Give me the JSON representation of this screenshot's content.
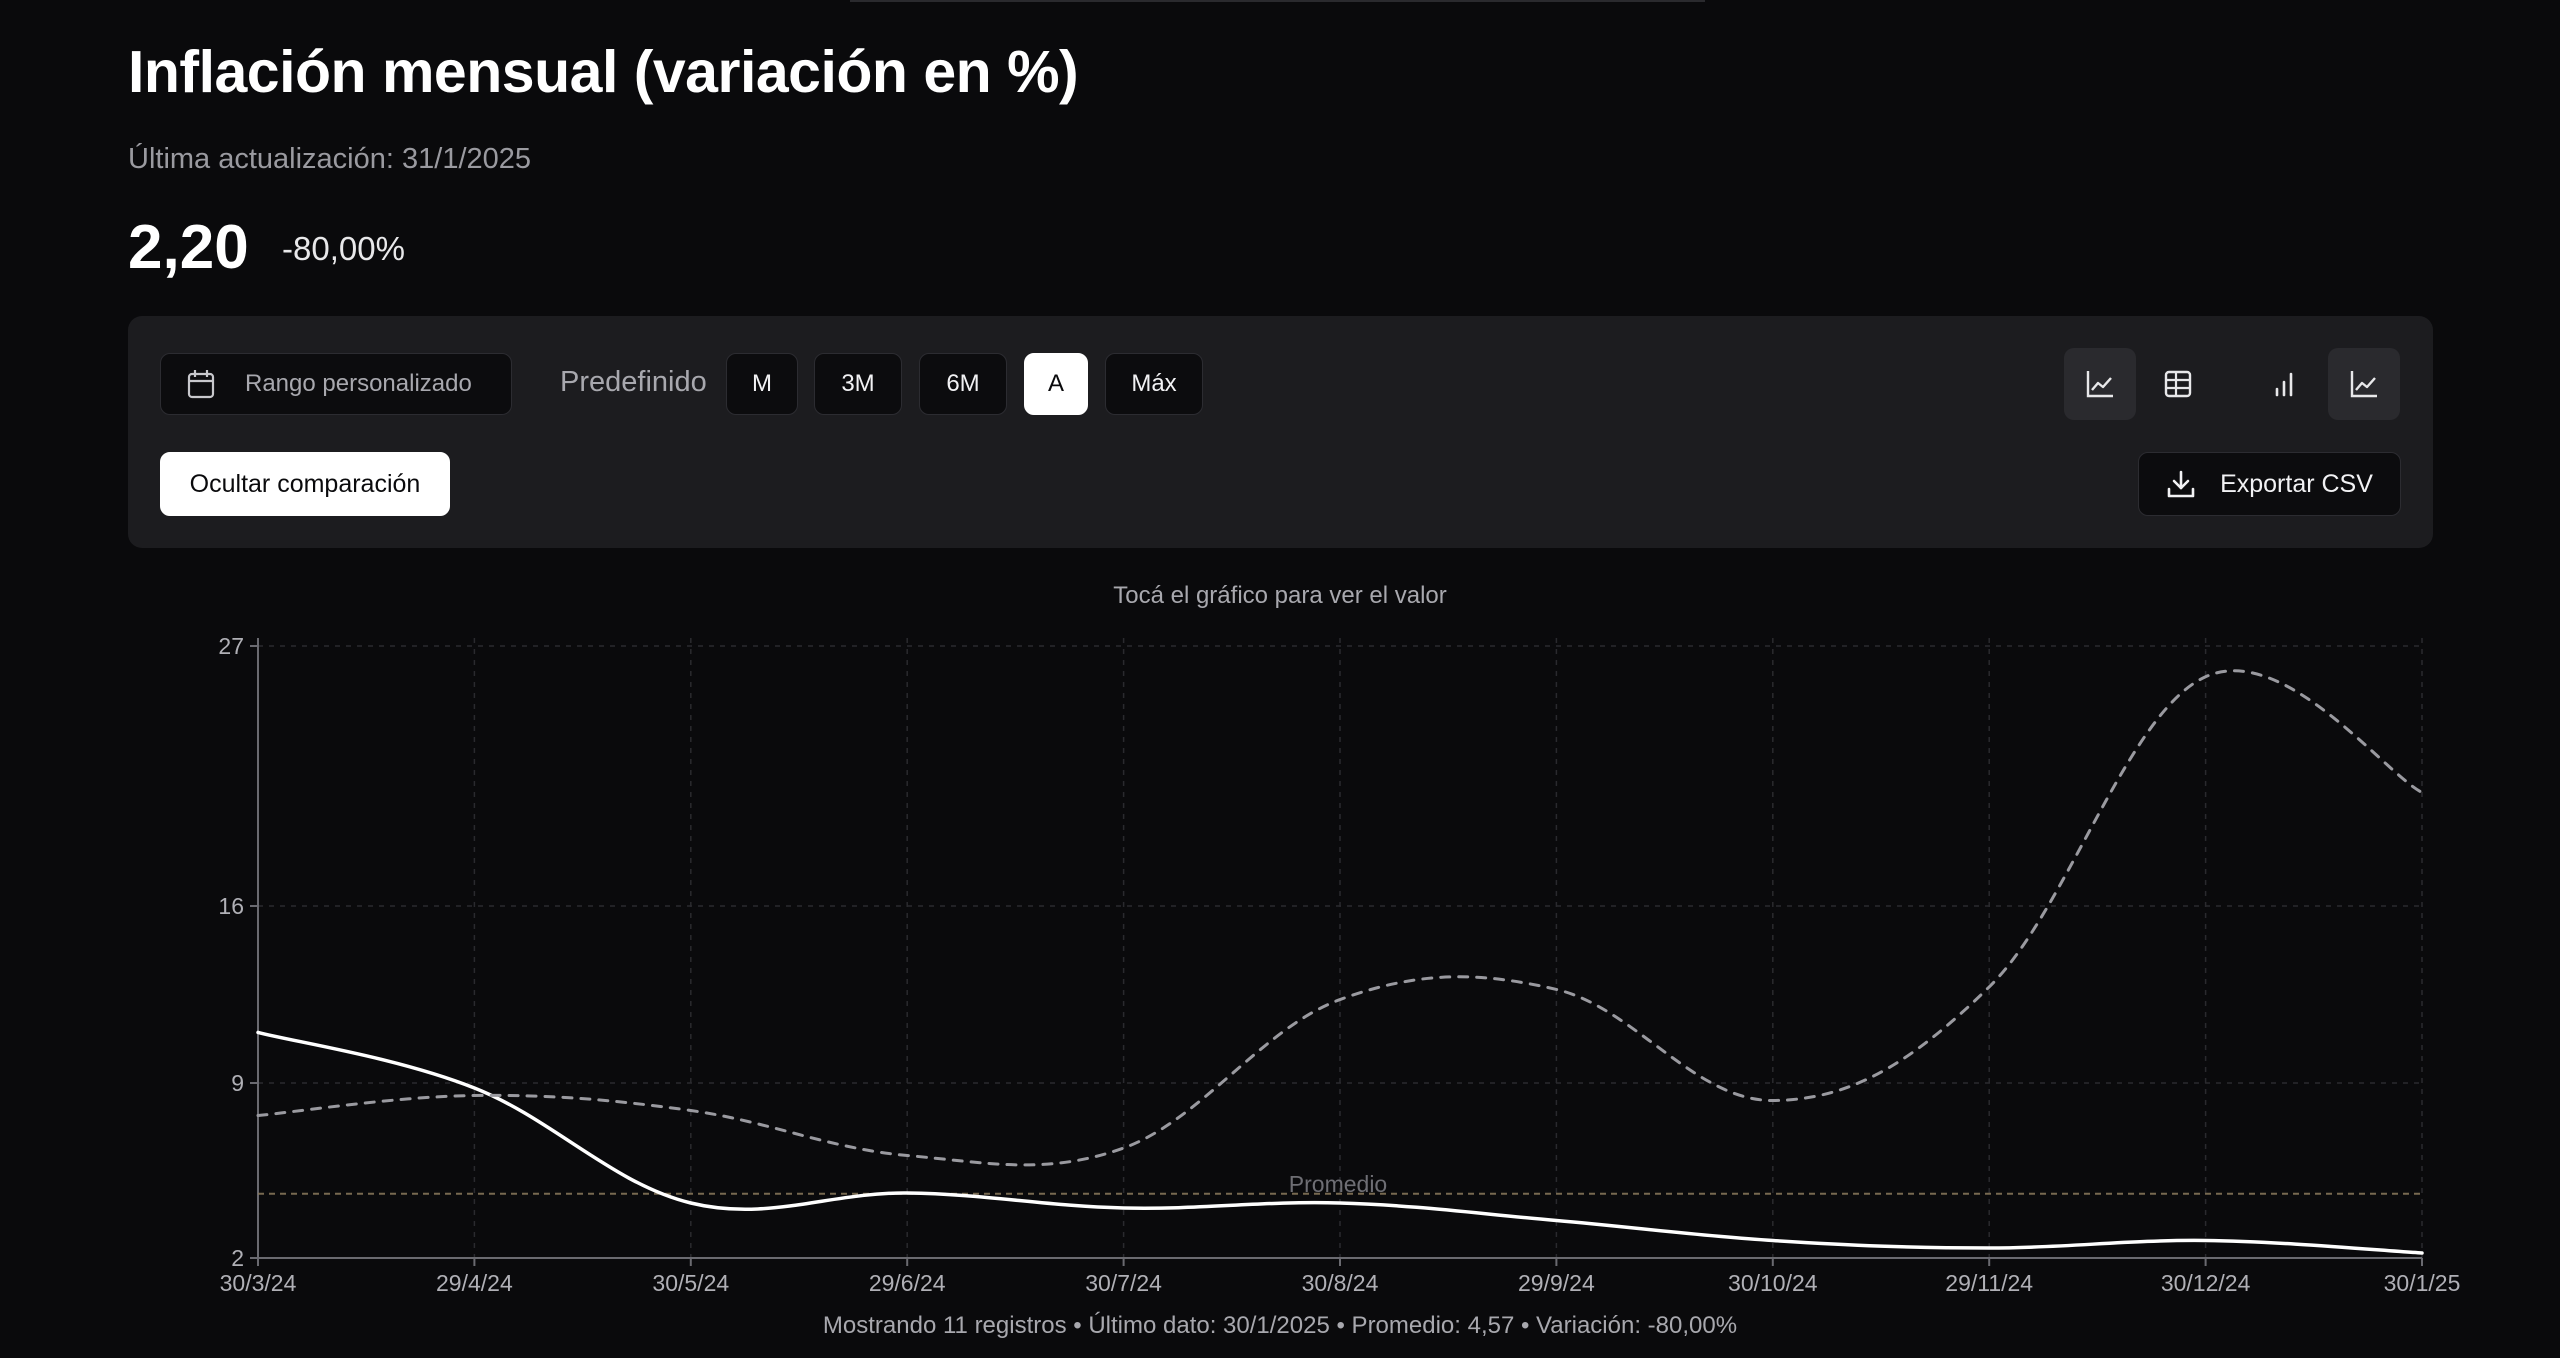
{
  "header": {
    "title": "Inflación mensual (variación en %)",
    "updated": "Última actualización: 31/1/2025",
    "value": "2,20",
    "change": "-80,00%"
  },
  "toolbar": {
    "range_label": "Rango personalizado",
    "preset_label": "Predefinido",
    "presets": [
      "M",
      "3M",
      "6M",
      "A",
      "Máx"
    ],
    "active_preset": "A",
    "hide_comparison_label": "Ocultar comparación",
    "export_label": "Exportar CSV",
    "view_icons": [
      "line-chart-icon",
      "table-icon",
      "bar-chart-icon",
      "line-chart-icon"
    ]
  },
  "hint": "Tocá el gráfico para ver el valor",
  "footer": "Mostrando 11 registros • Último dato: 30/1/2025 • Promedio: 4,57 • Variación: -80,00%",
  "chart_data": {
    "type": "line",
    "x": [
      "30/3/24",
      "29/4/24",
      "30/5/24",
      "29/6/24",
      "30/7/24",
      "30/8/24",
      "29/9/24",
      "30/10/24",
      "29/11/24",
      "30/12/24",
      "30/1/25"
    ],
    "yticks": [
      2,
      9,
      16,
      27
    ],
    "series": [
      {
        "values": [
          11.0,
          8.8,
          4.2,
          4.6,
          4.0,
          4.2,
          3.5,
          2.7,
          2.4,
          2.7,
          2.2
        ],
        "style": "solid",
        "color": "#ffffff"
      },
      {
        "values": [
          7.7,
          8.5,
          7.9,
          6.1,
          6.4,
          12.3,
          12.7,
          8.3,
          12.8,
          25.7,
          20.8
        ],
        "style": "dashed",
        "color": "#9a9aa0"
      }
    ],
    "average": {
      "label": "Promedio",
      "value": 4.57,
      "color": "#8a7a5c"
    },
    "grid": true
  }
}
